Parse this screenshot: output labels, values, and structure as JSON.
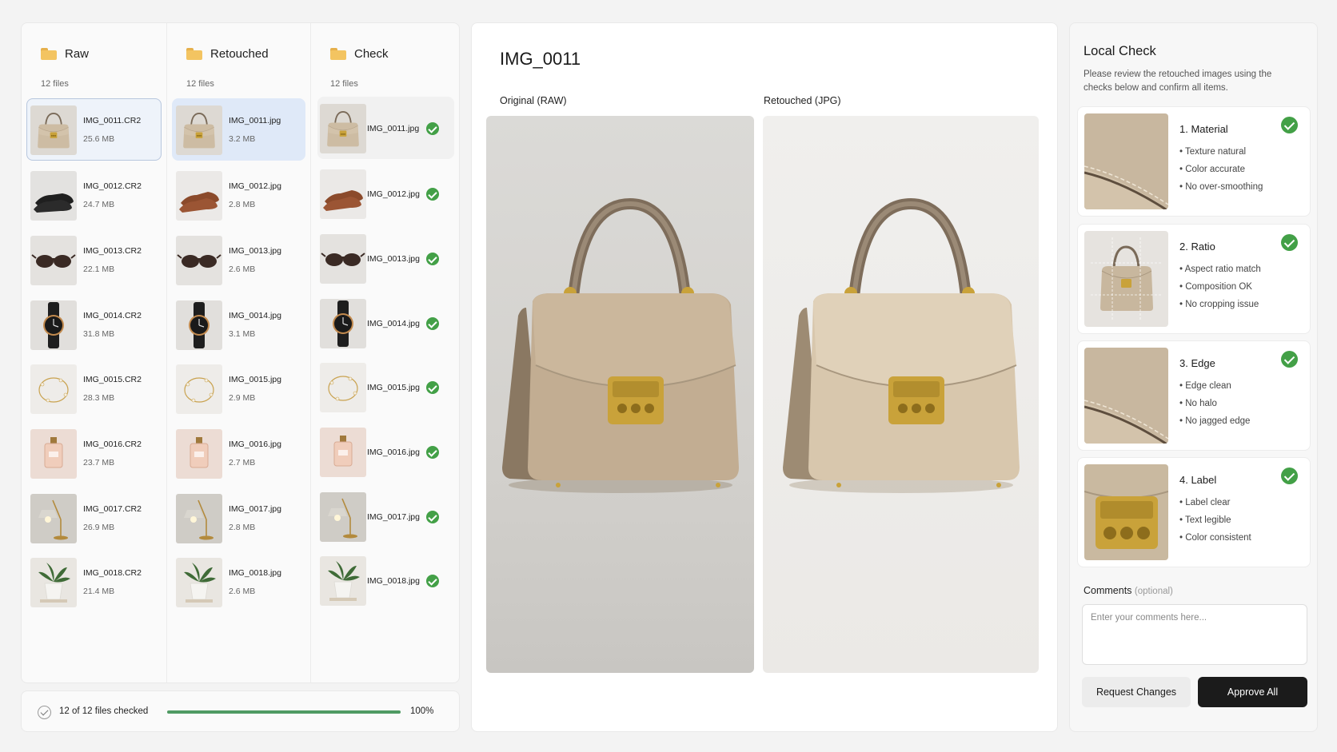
{
  "columns": [
    {
      "title": "Raw",
      "count": "12 files",
      "files": [
        {
          "name": "IMG_0011.CR2",
          "size": "25.6 MB",
          "thumb": "bag"
        },
        {
          "name": "IMG_0012.CR2",
          "size": "24.7 MB",
          "thumb": "black-shoes"
        },
        {
          "name": "IMG_0013.CR2",
          "size": "22.1 MB",
          "thumb": "sunglasses"
        },
        {
          "name": "IMG_0014.CR2",
          "size": "31.8 MB",
          "thumb": "watch"
        },
        {
          "name": "IMG_0015.CR2",
          "size": "28.3 MB",
          "thumb": "bracelet"
        },
        {
          "name": "IMG_0016.CR2",
          "size": "23.7 MB",
          "thumb": "perfume"
        },
        {
          "name": "IMG_0017.CR2",
          "size": "26.9 MB",
          "thumb": "lamp"
        },
        {
          "name": "IMG_0018.CR2",
          "size": "21.4 MB",
          "thumb": "plant"
        }
      ]
    },
    {
      "title": "Retouched",
      "count": "12 files",
      "files": [
        {
          "name": "IMG_0011.jpg",
          "size": "3.2 MB",
          "thumb": "bag"
        },
        {
          "name": "IMG_0012.jpg",
          "size": "2.8 MB",
          "thumb": "brown-shoes"
        },
        {
          "name": "IMG_0013.jpg",
          "size": "2.6 MB",
          "thumb": "sunglasses"
        },
        {
          "name": "IMG_0014.jpg",
          "size": "3.1 MB",
          "thumb": "watch"
        },
        {
          "name": "IMG_0015.jpg",
          "size": "2.9 MB",
          "thumb": "bracelet"
        },
        {
          "name": "IMG_0016.jpg",
          "size": "2.7 MB",
          "thumb": "perfume"
        },
        {
          "name": "IMG_0017.jpg",
          "size": "2.8 MB",
          "thumb": "lamp"
        },
        {
          "name": "IMG_0018.jpg",
          "size": "2.6 MB",
          "thumb": "plant"
        }
      ]
    },
    {
      "title": "Check",
      "count": "12 files",
      "files": [
        {
          "name": "IMG_0011.jpg",
          "thumb": "bag"
        },
        {
          "name": "IMG_0012.jpg",
          "thumb": "brown-shoes"
        },
        {
          "name": "IMG_0013.jpg",
          "thumb": "sunglasses"
        },
        {
          "name": "IMG_0014.jpg",
          "thumb": "watch"
        },
        {
          "name": "IMG_0015.jpg",
          "thumb": "bracelet"
        },
        {
          "name": "IMG_0016.jpg",
          "thumb": "perfume"
        },
        {
          "name": "IMG_0017.jpg",
          "thumb": "lamp"
        },
        {
          "name": "IMG_0018.jpg",
          "thumb": "plant"
        }
      ]
    }
  ],
  "progress": {
    "text": "12 of 12 files checked",
    "percent_label": "100%",
    "fraction": 1.0
  },
  "viewer": {
    "title": "IMG_0011",
    "original_label": "Original (RAW)",
    "retouched_label": "Retouched (JPG)"
  },
  "checks": {
    "title": "Local Check",
    "description": "Please review the retouched images using the checks below and confirm all items.",
    "items": [
      {
        "title": "1. Material",
        "points": [
          "Texture natural",
          "Color accurate",
          "No over-smoothing"
        ],
        "image": "leather-edge"
      },
      {
        "title": "2. Ratio",
        "points": [
          "Aspect ratio match",
          "Composition OK",
          "No cropping issue"
        ],
        "image": "bag-grid"
      },
      {
        "title": "3. Edge",
        "points": [
          "Edge clean",
          "No halo",
          "No jagged edge"
        ],
        "image": "leather-edge"
      },
      {
        "title": "4. Label",
        "points": [
          "Label clear",
          "Text legible",
          "Color consistent"
        ],
        "image": "clasp"
      }
    ],
    "comments_label": "Comments",
    "comments_optional": "(optional)",
    "comments_placeholder": "Enter your comments here...",
    "request_label": "Request Changes",
    "approve_label": "Approve All"
  },
  "colors": {
    "accent_green": "#43a047",
    "progress_green": "#4f9a63",
    "primary_button": "#1b1b1b",
    "selection_blue": "#dfe9f8"
  }
}
